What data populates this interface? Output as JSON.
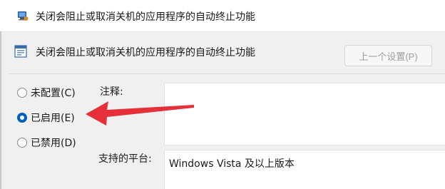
{
  "window": {
    "title": "关闭会阻止或取消关机的应用程序的自动终止功能"
  },
  "header": {
    "setting_name": "关闭会阻止或取消关机的应用程序的自动终止功能",
    "prev_button_label": "上一个设置(P)"
  },
  "options": [
    {
      "label": "未配置(C)",
      "checked": false
    },
    {
      "label": "已启用(E)",
      "checked": true
    },
    {
      "label": "已禁用(D)",
      "checked": false
    }
  ],
  "comment": {
    "label": "注释:",
    "value": ""
  },
  "supported": {
    "label": "支持的平台:",
    "value": "Windows Vista 及以上版本"
  },
  "colors": {
    "accent": "#005fb8",
    "annotation_arrow": "#e5303a"
  }
}
